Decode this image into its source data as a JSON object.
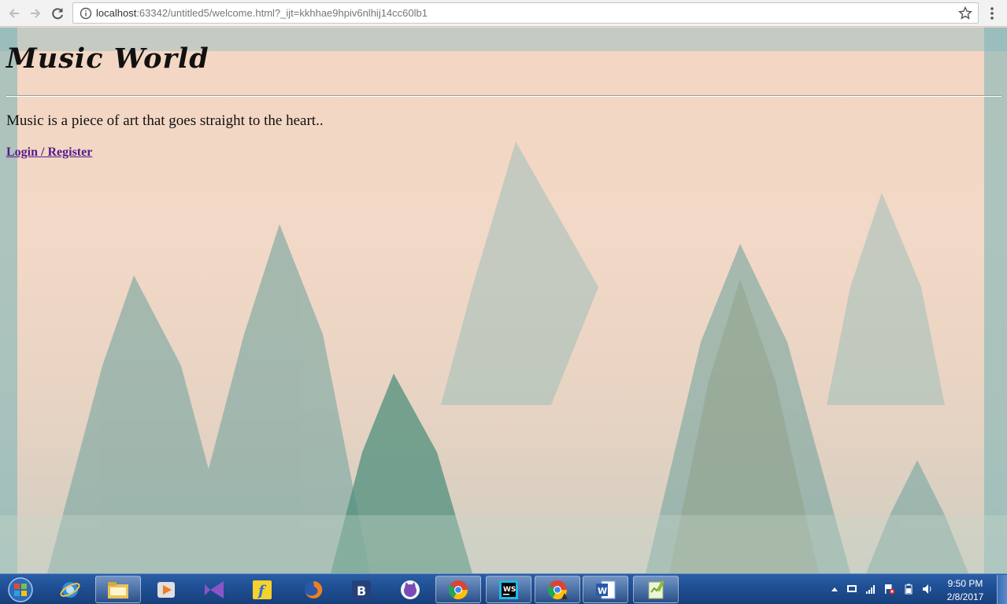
{
  "browser": {
    "url_host": "localhost",
    "url_rest": ":63342/untitled5/welcome.html?_ijt=kkhhae9hpiv6nlhij14cc60lb1",
    "icons": {
      "back": "arrow-left-icon",
      "forward": "arrow-right-icon",
      "reload": "reload-icon",
      "info": "info-icon",
      "bookmark": "star-icon",
      "menu": "kebab-menu-icon"
    }
  },
  "page": {
    "title": "Music World",
    "tagline": "Music is a piece of art that goes straight to the heart..",
    "login_link": "Login / Register",
    "colors": {
      "background": "#f2d9c6",
      "link": "#551a8b",
      "trees": "#5f9e8f"
    }
  },
  "taskbar": {
    "items": [
      "windows-start-icon",
      "internet-explorer-icon",
      "file-explorer-icon",
      "media-player-icon",
      "visual-studio-icon",
      "flipkart-icon",
      "firefox-icon",
      "booking-icon",
      "github-desktop-icon",
      "chrome-icon",
      "webstorm-icon",
      "chrome-canary-icon",
      "word-icon",
      "notepad-plus-plus-icon"
    ],
    "clock_time": "9:50 PM",
    "clock_date": "2/8/2017"
  }
}
